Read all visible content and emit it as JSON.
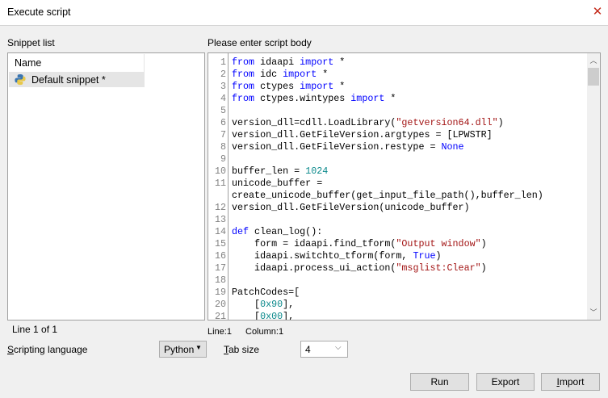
{
  "window": {
    "title": "Execute script",
    "close_icon": "close-icon"
  },
  "snippets": {
    "label": "Snippet list",
    "column_header": "Name",
    "items": [
      {
        "label": "Default snippet *",
        "icon": "python-icon"
      }
    ],
    "status": "Line 1 of 1"
  },
  "editor": {
    "label": "Please enter script body",
    "status_line": "Line:1",
    "status_column": "Column:1",
    "colors": {
      "keyword": "#0000ff",
      "number": "#09888a",
      "string": "#a31515"
    },
    "lines": [
      {
        "num": "1",
        "tokens": [
          {
            "t": "from",
            "c": "kw"
          },
          {
            "t": " idaapi "
          },
          {
            "t": "import",
            "c": "kw"
          },
          {
            "t": " *"
          }
        ]
      },
      {
        "num": "2",
        "tokens": [
          {
            "t": "from",
            "c": "kw"
          },
          {
            "t": " idc "
          },
          {
            "t": "import",
            "c": "kw"
          },
          {
            "t": " *"
          }
        ]
      },
      {
        "num": "3",
        "tokens": [
          {
            "t": "from",
            "c": "kw"
          },
          {
            "t": " ctypes "
          },
          {
            "t": "import",
            "c": "kw"
          },
          {
            "t": " *"
          }
        ]
      },
      {
        "num": "4",
        "tokens": [
          {
            "t": "from",
            "c": "kw"
          },
          {
            "t": " ctypes.wintypes "
          },
          {
            "t": "import",
            "c": "kw"
          },
          {
            "t": " *"
          }
        ]
      },
      {
        "num": "5",
        "tokens": []
      },
      {
        "num": "6",
        "tokens": [
          {
            "t": "version_dll=cdll.LoadLibrary("
          },
          {
            "t": "\"getversion64.dll\"",
            "c": "str"
          },
          {
            "t": ")"
          }
        ]
      },
      {
        "num": "7",
        "tokens": [
          {
            "t": "version_dll.GetFileVersion.argtypes = [LPWSTR]"
          }
        ]
      },
      {
        "num": "8",
        "tokens": [
          {
            "t": "version_dll.GetFileVersion.restype = "
          },
          {
            "t": "None",
            "c": "kw"
          }
        ]
      },
      {
        "num": "9",
        "tokens": []
      },
      {
        "num": "10",
        "tokens": [
          {
            "t": "buffer_len = "
          },
          {
            "t": "1024",
            "c": "num"
          }
        ]
      },
      {
        "num": "11",
        "tokens": [
          {
            "t": "unicode_buffer ="
          }
        ]
      },
      {
        "num": "",
        "tokens": [
          {
            "t": "create_unicode_buffer(get_input_file_path(),buffer_len)"
          }
        ]
      },
      {
        "num": "12",
        "tokens": [
          {
            "t": "version_dll.GetFileVersion(unicode_buffer)"
          }
        ]
      },
      {
        "num": "13",
        "tokens": []
      },
      {
        "num": "14",
        "tokens": [
          {
            "t": "def",
            "c": "kw"
          },
          {
            "t": " clean_log():"
          }
        ]
      },
      {
        "num": "15",
        "tokens": [
          {
            "t": "    form = idaapi.find_tform("
          },
          {
            "t": "\"Output window\"",
            "c": "str"
          },
          {
            "t": ")"
          }
        ]
      },
      {
        "num": "16",
        "tokens": [
          {
            "t": "    idaapi.switchto_tform(form, "
          },
          {
            "t": "True",
            "c": "kw"
          },
          {
            "t": ")"
          }
        ]
      },
      {
        "num": "17",
        "tokens": [
          {
            "t": "    idaapi.process_ui_action("
          },
          {
            "t": "\"msglist:Clear\"",
            "c": "str"
          },
          {
            "t": ")"
          }
        ]
      },
      {
        "num": "18",
        "tokens": []
      },
      {
        "num": "19",
        "tokens": [
          {
            "t": "PatchCodes=["
          }
        ]
      },
      {
        "num": "20",
        "tokens": [
          {
            "t": "    ["
          },
          {
            "t": "0x90",
            "c": "num"
          },
          {
            "t": "],"
          }
        ]
      },
      {
        "num": "21",
        "tokens": [
          {
            "t": "    ["
          },
          {
            "t": "0x00",
            "c": "num"
          },
          {
            "t": "],"
          }
        ]
      }
    ]
  },
  "options": {
    "language_label": "Scripting language",
    "language_value": "Python",
    "tab_label": "Tab size",
    "tab_value": "4"
  },
  "buttons": {
    "run": "Run",
    "export": "Export",
    "import": "Import"
  }
}
